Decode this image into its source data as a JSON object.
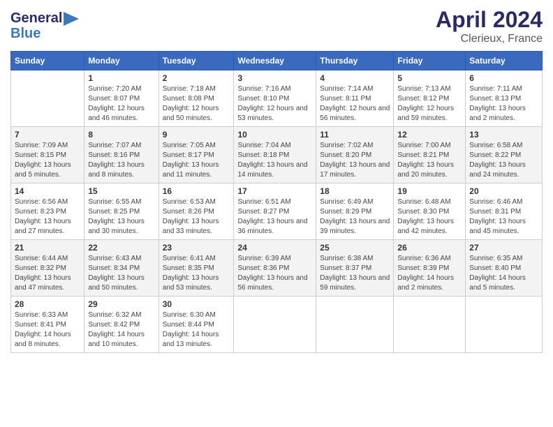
{
  "logo": {
    "line1": "General",
    "line2": "Blue",
    "arrow_color": "#3a7abf"
  },
  "title": "April 2024",
  "subtitle": "Clerieux, France",
  "days_of_week": [
    "Sunday",
    "Monday",
    "Tuesday",
    "Wednesday",
    "Thursday",
    "Friday",
    "Saturday"
  ],
  "weeks": [
    [
      {
        "num": "",
        "sunrise": "",
        "sunset": "",
        "daylight": ""
      },
      {
        "num": "1",
        "sunrise": "Sunrise: 7:20 AM",
        "sunset": "Sunset: 8:07 PM",
        "daylight": "Daylight: 12 hours and 46 minutes."
      },
      {
        "num": "2",
        "sunrise": "Sunrise: 7:18 AM",
        "sunset": "Sunset: 8:08 PM",
        "daylight": "Daylight: 12 hours and 50 minutes."
      },
      {
        "num": "3",
        "sunrise": "Sunrise: 7:16 AM",
        "sunset": "Sunset: 8:10 PM",
        "daylight": "Daylight: 12 hours and 53 minutes."
      },
      {
        "num": "4",
        "sunrise": "Sunrise: 7:14 AM",
        "sunset": "Sunset: 8:11 PM",
        "daylight": "Daylight: 12 hours and 56 minutes."
      },
      {
        "num": "5",
        "sunrise": "Sunrise: 7:13 AM",
        "sunset": "Sunset: 8:12 PM",
        "daylight": "Daylight: 12 hours and 59 minutes."
      },
      {
        "num": "6",
        "sunrise": "Sunrise: 7:11 AM",
        "sunset": "Sunset: 8:13 PM",
        "daylight": "Daylight: 13 hours and 2 minutes."
      }
    ],
    [
      {
        "num": "7",
        "sunrise": "Sunrise: 7:09 AM",
        "sunset": "Sunset: 8:15 PM",
        "daylight": "Daylight: 13 hours and 5 minutes."
      },
      {
        "num": "8",
        "sunrise": "Sunrise: 7:07 AM",
        "sunset": "Sunset: 8:16 PM",
        "daylight": "Daylight: 13 hours and 8 minutes."
      },
      {
        "num": "9",
        "sunrise": "Sunrise: 7:05 AM",
        "sunset": "Sunset: 8:17 PM",
        "daylight": "Daylight: 13 hours and 11 minutes."
      },
      {
        "num": "10",
        "sunrise": "Sunrise: 7:04 AM",
        "sunset": "Sunset: 8:18 PM",
        "daylight": "Daylight: 13 hours and 14 minutes."
      },
      {
        "num": "11",
        "sunrise": "Sunrise: 7:02 AM",
        "sunset": "Sunset: 8:20 PM",
        "daylight": "Daylight: 13 hours and 17 minutes."
      },
      {
        "num": "12",
        "sunrise": "Sunrise: 7:00 AM",
        "sunset": "Sunset: 8:21 PM",
        "daylight": "Daylight: 13 hours and 20 minutes."
      },
      {
        "num": "13",
        "sunrise": "Sunrise: 6:58 AM",
        "sunset": "Sunset: 8:22 PM",
        "daylight": "Daylight: 13 hours and 24 minutes."
      }
    ],
    [
      {
        "num": "14",
        "sunrise": "Sunrise: 6:56 AM",
        "sunset": "Sunset: 8:23 PM",
        "daylight": "Daylight: 13 hours and 27 minutes."
      },
      {
        "num": "15",
        "sunrise": "Sunrise: 6:55 AM",
        "sunset": "Sunset: 8:25 PM",
        "daylight": "Daylight: 13 hours and 30 minutes."
      },
      {
        "num": "16",
        "sunrise": "Sunrise: 6:53 AM",
        "sunset": "Sunset: 8:26 PM",
        "daylight": "Daylight: 13 hours and 33 minutes."
      },
      {
        "num": "17",
        "sunrise": "Sunrise: 6:51 AM",
        "sunset": "Sunset: 8:27 PM",
        "daylight": "Daylight: 13 hours and 36 minutes."
      },
      {
        "num": "18",
        "sunrise": "Sunrise: 6:49 AM",
        "sunset": "Sunset: 8:29 PM",
        "daylight": "Daylight: 13 hours and 39 minutes."
      },
      {
        "num": "19",
        "sunrise": "Sunrise: 6:48 AM",
        "sunset": "Sunset: 8:30 PM",
        "daylight": "Daylight: 13 hours and 42 minutes."
      },
      {
        "num": "20",
        "sunrise": "Sunrise: 6:46 AM",
        "sunset": "Sunset: 8:31 PM",
        "daylight": "Daylight: 13 hours and 45 minutes."
      }
    ],
    [
      {
        "num": "21",
        "sunrise": "Sunrise: 6:44 AM",
        "sunset": "Sunset: 8:32 PM",
        "daylight": "Daylight: 13 hours and 47 minutes."
      },
      {
        "num": "22",
        "sunrise": "Sunrise: 6:43 AM",
        "sunset": "Sunset: 8:34 PM",
        "daylight": "Daylight: 13 hours and 50 minutes."
      },
      {
        "num": "23",
        "sunrise": "Sunrise: 6:41 AM",
        "sunset": "Sunset: 8:35 PM",
        "daylight": "Daylight: 13 hours and 53 minutes."
      },
      {
        "num": "24",
        "sunrise": "Sunrise: 6:39 AM",
        "sunset": "Sunset: 8:36 PM",
        "daylight": "Daylight: 13 hours and 56 minutes."
      },
      {
        "num": "25",
        "sunrise": "Sunrise: 6:38 AM",
        "sunset": "Sunset: 8:37 PM",
        "daylight": "Daylight: 13 hours and 59 minutes."
      },
      {
        "num": "26",
        "sunrise": "Sunrise: 6:36 AM",
        "sunset": "Sunset: 8:39 PM",
        "daylight": "Daylight: 14 hours and 2 minutes."
      },
      {
        "num": "27",
        "sunrise": "Sunrise: 6:35 AM",
        "sunset": "Sunset: 8:40 PM",
        "daylight": "Daylight: 14 hours and 5 minutes."
      }
    ],
    [
      {
        "num": "28",
        "sunrise": "Sunrise: 6:33 AM",
        "sunset": "Sunset: 8:41 PM",
        "daylight": "Daylight: 14 hours and 8 minutes."
      },
      {
        "num": "29",
        "sunrise": "Sunrise: 6:32 AM",
        "sunset": "Sunset: 8:42 PM",
        "daylight": "Daylight: 14 hours and 10 minutes."
      },
      {
        "num": "30",
        "sunrise": "Sunrise: 6:30 AM",
        "sunset": "Sunset: 8:44 PM",
        "daylight": "Daylight: 14 hours and 13 minutes."
      },
      {
        "num": "",
        "sunrise": "",
        "sunset": "",
        "daylight": ""
      },
      {
        "num": "",
        "sunrise": "",
        "sunset": "",
        "daylight": ""
      },
      {
        "num": "",
        "sunrise": "",
        "sunset": "",
        "daylight": ""
      },
      {
        "num": "",
        "sunrise": "",
        "sunset": "",
        "daylight": ""
      }
    ]
  ]
}
